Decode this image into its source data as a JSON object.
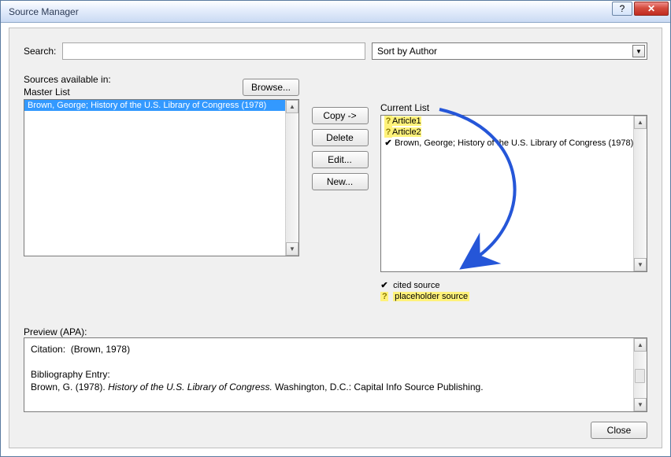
{
  "window": {
    "title": "Source Manager"
  },
  "search": {
    "label": "Search:",
    "value": "",
    "sort": "Sort by Author"
  },
  "labels": {
    "sources_available": "Sources available in:",
    "master_list": "Master List",
    "current_list": "Current List",
    "browse": "Browse...",
    "preview": "Preview (APA):",
    "close": "Close"
  },
  "mid_buttons": {
    "copy": "Copy ->",
    "delete": "Delete",
    "edit": "Edit...",
    "new": "New..."
  },
  "master_list": [
    {
      "text": "Brown, George; History of the U.S. Library of Congress (1978)",
      "selected": true
    }
  ],
  "current_list": [
    {
      "mark": "?",
      "text": "Article1",
      "highlight": true
    },
    {
      "mark": "?",
      "text": "Article2",
      "highlight": true
    },
    {
      "mark": "✔",
      "text": "Brown, George; History of the U.S. Library of Congress (1978)",
      "highlight": false
    }
  ],
  "legend": {
    "cited_mark": "✔",
    "cited_label": "cited source",
    "placeholder_mark": "?",
    "placeholder_label": "placeholder source"
  },
  "preview": {
    "citation_label": "Citation:",
    "citation_text": "(Brown, 1978)",
    "bib_label": "Bibliography Entry:",
    "bib_author": "Brown, G.",
    "bib_year": "(1978).",
    "bib_title": "History of the U.S. Library of Congress.",
    "bib_pub": "Washington, D.C.: Capital Info Source Publishing."
  }
}
